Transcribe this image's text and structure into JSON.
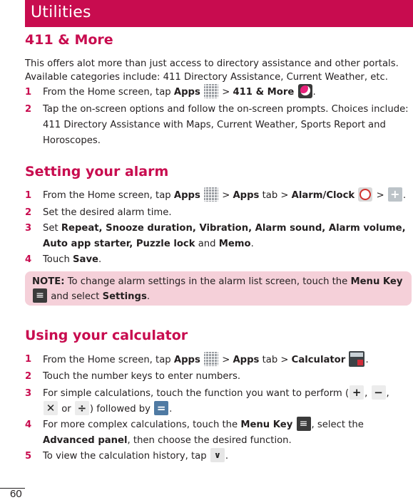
{
  "header": {
    "title": "Utilities"
  },
  "sections": {
    "more411": {
      "title": "411 & More",
      "intro_line1": "This offers alot more than just access to directory assistance and other portals.",
      "intro_line2": "Available categories include: 411 Directory Assistance, Current Weather, etc.",
      "steps": [
        {
          "num": "1",
          "pre": "From the Home screen, tap ",
          "apps": "Apps",
          "sep": " > ",
          "target": "411 & More",
          "end": "."
        },
        {
          "num": "2",
          "text": "Tap the on-screen options and follow the on-screen prompts. Choices include: 411 Directory Assistance with Maps, Current Weather, Sports Report and Horoscopes."
        }
      ]
    },
    "alarm": {
      "title": "Setting your alarm",
      "steps": [
        {
          "num": "1",
          "pre": "From the Home screen, tap ",
          "apps": "Apps",
          "sep": " > ",
          "apps_tab": "Apps",
          "tab_word": " tab > ",
          "target": "Alarm/Clock",
          "sep2": " > ",
          "end": "."
        },
        {
          "num": "2",
          "text": "Set the desired alarm time."
        },
        {
          "num": "3",
          "pre": "Set ",
          "items": "Repeat, Snooze duration, Vibration, Alarm sound, Alarm volume, Auto app starter, Puzzle lock",
          "and": " and ",
          "last": "Memo",
          "end": "."
        },
        {
          "num": "4",
          "pre": "Touch ",
          "bold": "Save",
          "end": "."
        }
      ],
      "note": {
        "label": "NOTE:",
        "text": " To change alarm settings in the alarm list screen, touch the ",
        "key": "Menu Key",
        "and": " and select ",
        "settings": "Settings",
        "end": "."
      }
    },
    "calculator": {
      "title": "Using your calculator",
      "steps": [
        {
          "num": "1",
          "pre": "From the Home screen, tap ",
          "apps": "Apps",
          "sep": " > ",
          "apps_tab": "Apps",
          "tab_word": " tab > ",
          "target": "Calculator",
          "end": "."
        },
        {
          "num": "2",
          "text": "Touch the number keys to enter numbers."
        },
        {
          "num": "3",
          "pre": "For simple calculations, touch the function you want to perform (",
          "comma": ", ",
          "or": " or ",
          "followed": ") followed by ",
          "end": "."
        },
        {
          "num": "4",
          "pre": "For more complex calculations, touch the ",
          "key": "Menu Key",
          "mid": ", select the ",
          "panel": "Advanced panel",
          "end": ", then choose the desired function."
        },
        {
          "num": "5",
          "pre": "To view the calculation history, tap ",
          "end": "."
        }
      ]
    }
  },
  "icons": {
    "plus": "+",
    "minus": "−",
    "times": "✕",
    "divide": "÷",
    "equals": "=",
    "menu": "≡",
    "down": "∨"
  },
  "page_number": "60"
}
